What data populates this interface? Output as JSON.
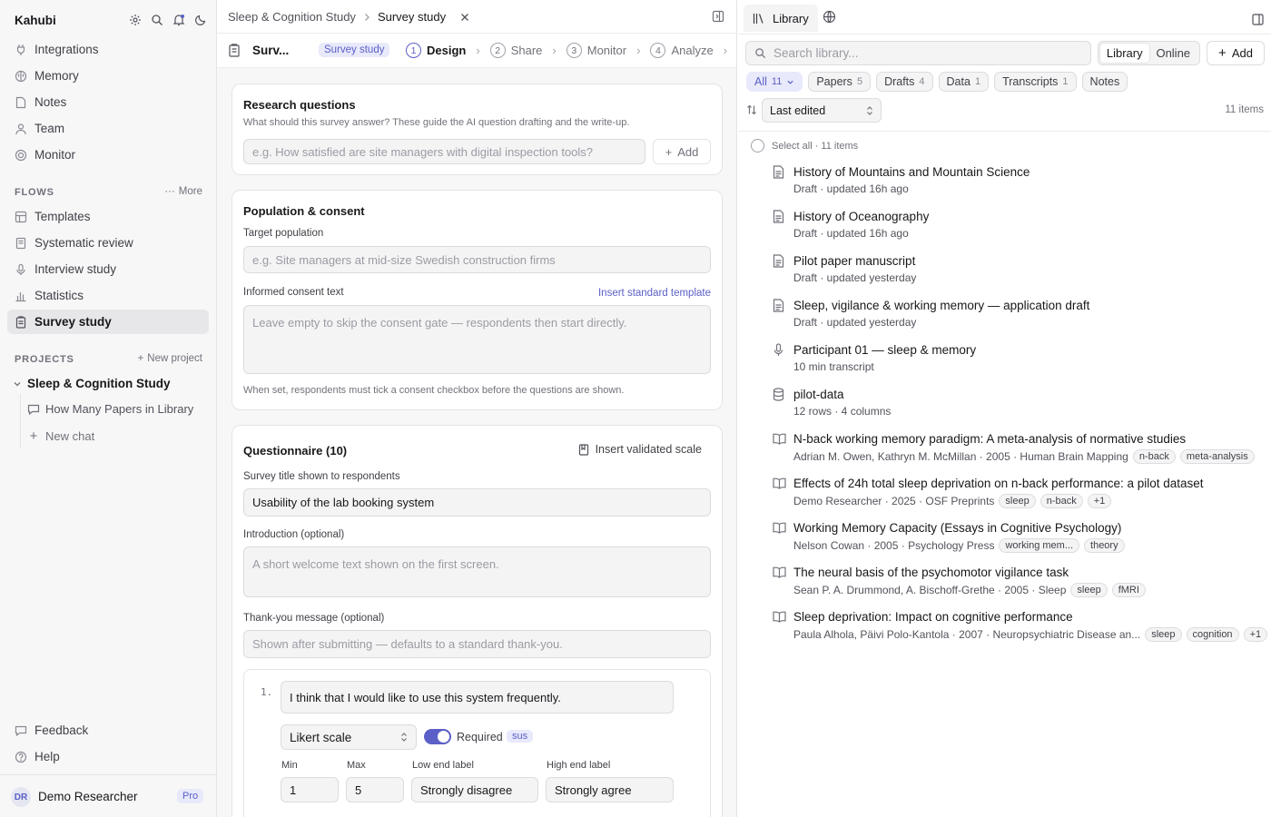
{
  "sidebar": {
    "brand": "Kahubi",
    "nav": [
      "Integrations",
      "Memory",
      "Notes",
      "Team",
      "Monitor"
    ],
    "flows_label": "FLOWS",
    "flows_more": "More",
    "flows": [
      "Templates",
      "Systematic review",
      "Interview study",
      "Statistics",
      "Survey study"
    ],
    "projects_label": "PROJECTS",
    "new_project": "New project",
    "project": "Sleep & Cognition Study",
    "project_chat": "How Many Papers in Library",
    "new_chat": "New chat",
    "footer": [
      "Feedback",
      "Help"
    ],
    "user_initials": "DR",
    "user_name": "Demo Researcher",
    "plan": "Pro"
  },
  "middle": {
    "breadcrumb": [
      "Sleep & Cognition Study",
      "Survey study"
    ],
    "survey_short": "Surv...",
    "survey_pill": "Survey study",
    "steps": [
      {
        "num": "1",
        "label": "Design"
      },
      {
        "num": "2",
        "label": "Share"
      },
      {
        "num": "3",
        "label": "Monitor"
      },
      {
        "num": "4",
        "label": "Analyze"
      }
    ],
    "research": {
      "title": "Research questions",
      "subtitle": "What should this survey answer? These guide the AI question drafting and the write-up.",
      "placeholder": "e.g. How satisfied are site managers with digital inspection tools?",
      "add": "Add"
    },
    "population": {
      "title": "Population & consent",
      "target_label": "Target population",
      "target_placeholder": "e.g. Site managers at mid-size Swedish construction firms",
      "consent_label": "Informed consent text",
      "insert_template": "Insert standard template",
      "consent_placeholder": "Leave empty to skip the consent gate — respondents then start directly.",
      "note": "When set, respondents must tick a consent checkbox before the questions are shown."
    },
    "questionnaire": {
      "title": "Questionnaire (10)",
      "insert_scale": "Insert validated scale",
      "survey_title_label": "Survey title shown to respondents",
      "survey_title_value": "Usability of the lab booking system",
      "intro_label": "Introduction (optional)",
      "intro_placeholder": "A short welcome text shown on the first screen.",
      "thanks_label": "Thank-you message (optional)",
      "thanks_placeholder": "Shown after submitting — defaults to a standard thank-you.",
      "q1": {
        "num": "1.",
        "text": "I think that I would like to use this system frequently.",
        "type": "Likert scale",
        "required_label": "Required",
        "tag": "sus",
        "min_label": "Min",
        "min": "1",
        "max_label": "Max",
        "max": "5",
        "low_label": "Low end label",
        "low": "Strongly disagree",
        "high_label": "High end label",
        "high": "Strongly agree"
      }
    }
  },
  "library": {
    "tab": "Library",
    "search_placeholder": "Search library...",
    "seg": [
      "Library",
      "Online"
    ],
    "add": "Add",
    "chips": [
      {
        "label": "All",
        "count": "11"
      },
      {
        "label": "Papers",
        "count": "5"
      },
      {
        "label": "Drafts",
        "count": "4"
      },
      {
        "label": "Data",
        "count": "1"
      },
      {
        "label": "Transcripts",
        "count": "1"
      },
      {
        "label": "Notes",
        "count": ""
      }
    ],
    "sort": "Last edited",
    "count": "11 items",
    "select_all": "Select all · 11 items",
    "items": [
      {
        "icon": "document-icon",
        "title": "History of Mountains and Mountain Science",
        "meta": "Draft · updated 16h ago",
        "tags": []
      },
      {
        "icon": "document-icon",
        "title": "History of Oceanography",
        "meta": "Draft · updated 16h ago",
        "tags": []
      },
      {
        "icon": "document-icon",
        "title": "Pilot paper manuscript",
        "meta": "Draft · updated yesterday",
        "tags": []
      },
      {
        "icon": "document-icon",
        "title": "Sleep, vigilance & working memory — application draft",
        "meta": "Draft · updated yesterday",
        "tags": []
      },
      {
        "icon": "microphone-icon",
        "title": "Participant 01 — sleep & memory",
        "meta": "10 min transcript",
        "tags": []
      },
      {
        "icon": "database-icon",
        "title": "pilot-data",
        "meta": "12 rows · 4 columns",
        "tags": []
      },
      {
        "icon": "book-icon",
        "title": "N-back working memory paradigm: A meta-analysis of normative studies",
        "meta": "Adrian M. Owen, Kathryn M. McMillan · 2005 · Human Brain Mapping",
        "tags": [
          "n-back",
          "meta-analysis"
        ]
      },
      {
        "icon": "book-icon",
        "title": "Effects of 24h total sleep deprivation on n-back performance: a pilot dataset",
        "meta": "Demo Researcher · 2025 · OSF Preprints",
        "tags": [
          "sleep",
          "n-back",
          "+1"
        ]
      },
      {
        "icon": "book-icon",
        "title": "Working Memory Capacity (Essays in Cognitive Psychology)",
        "meta": "Nelson Cowan · 2005 · Psychology Press",
        "tags": [
          "working mem...",
          "theory"
        ]
      },
      {
        "icon": "book-icon",
        "title": "The neural basis of the psychomotor vigilance task",
        "meta": "Sean P. A. Drummond, A. Bischoff-Grethe · 2005 · Sleep",
        "tags": [
          "sleep",
          "fMRI"
        ]
      },
      {
        "icon": "book-icon",
        "title": "Sleep deprivation: Impact on cognitive performance",
        "meta": "Paula Alhola, Päivi Polo-Kantola · 2007 · Neuropsychiatric Disease an...",
        "tags": [
          "sleep",
          "cognition",
          "+1"
        ]
      }
    ]
  }
}
